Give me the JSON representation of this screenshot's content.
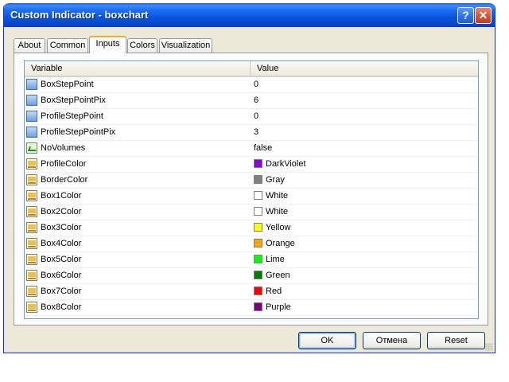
{
  "window": {
    "title": "Custom Indicator - boxchart",
    "help_label": "?",
    "close_label": "✕"
  },
  "tabs": [
    "About",
    "Common",
    "Inputs",
    "Colors",
    "Visualization"
  ],
  "active_tab": "Inputs",
  "table": {
    "headers": {
      "variable": "Variable",
      "value": "Value"
    },
    "rows": [
      {
        "variable": "BoxStepPoint",
        "value": "0",
        "icon": "number-icon"
      },
      {
        "variable": "BoxStepPointPix",
        "value": "6",
        "icon": "number-icon"
      },
      {
        "variable": "ProfileStepPoint",
        "value": "0",
        "icon": "number-icon"
      },
      {
        "variable": "ProfileStepPointPix",
        "value": "3",
        "icon": "number-icon"
      },
      {
        "variable": "NoVolumes",
        "value": "false",
        "icon": "boolean-icon"
      },
      {
        "variable": "ProfileColor",
        "value": "DarkViolet",
        "icon": "color-icon",
        "color": "#9400d3"
      },
      {
        "variable": "BorderColor",
        "value": "Gray",
        "icon": "color-icon",
        "color": "#808080"
      },
      {
        "variable": "Box1Color",
        "value": "White",
        "icon": "color-icon",
        "color": "#ffffff"
      },
      {
        "variable": "Box2Color",
        "value": "White",
        "icon": "color-icon",
        "color": "#ffffff"
      },
      {
        "variable": "Box3Color",
        "value": "Yellow",
        "icon": "color-icon",
        "color": "#ffff00"
      },
      {
        "variable": "Box4Color",
        "value": "Orange",
        "icon": "color-icon",
        "color": "#ffa500"
      },
      {
        "variable": "Box5Color",
        "value": "Lime",
        "icon": "color-icon",
        "color": "#00ff00"
      },
      {
        "variable": "Box6Color",
        "value": "Green",
        "icon": "color-icon",
        "color": "#008000"
      },
      {
        "variable": "Box7Color",
        "value": "Red",
        "icon": "color-icon",
        "color": "#ff0000"
      },
      {
        "variable": "Box8Color",
        "value": "Purple",
        "icon": "color-icon",
        "color": "#800080"
      }
    ]
  },
  "buttons": {
    "ok": "OK",
    "cancel": "Отмена",
    "reset": "Reset"
  }
}
